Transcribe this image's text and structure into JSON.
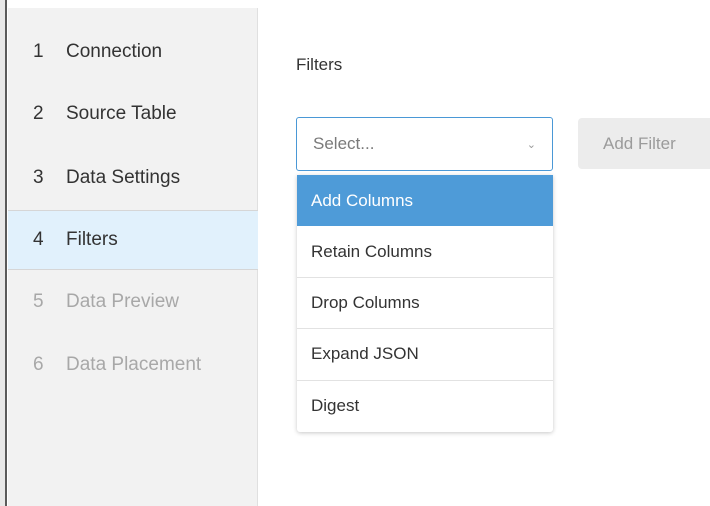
{
  "sidebar": {
    "steps": [
      {
        "number": "1",
        "label": "Connection",
        "state": "done"
      },
      {
        "number": "2",
        "label": "Source Table",
        "state": "done"
      },
      {
        "number": "3",
        "label": "Data Settings",
        "state": "done"
      },
      {
        "number": "4",
        "label": "Filters",
        "state": "active"
      },
      {
        "number": "5",
        "label": "Data Preview",
        "state": "disabled"
      },
      {
        "number": "6",
        "label": "Data Placement",
        "state": "disabled"
      }
    ]
  },
  "main": {
    "section_label": "Filters",
    "select": {
      "placeholder": "Select...",
      "chevron": "chevron-down-icon"
    },
    "add_filter_label": "Add Filter",
    "dropdown": {
      "options": [
        {
          "label": "Add Columns",
          "highlighted": true
        },
        {
          "label": "Retain Columns",
          "highlighted": false
        },
        {
          "label": "Drop Columns",
          "highlighted": false
        },
        {
          "label": "Expand JSON",
          "highlighted": false
        },
        {
          "label": "Digest",
          "highlighted": false
        }
      ]
    }
  },
  "colors": {
    "accent": "#4e9bd8",
    "active_step_bg": "#e1f1fc",
    "sidebar_bg": "#f2f2f2",
    "disabled_text": "#a8a8a8"
  }
}
